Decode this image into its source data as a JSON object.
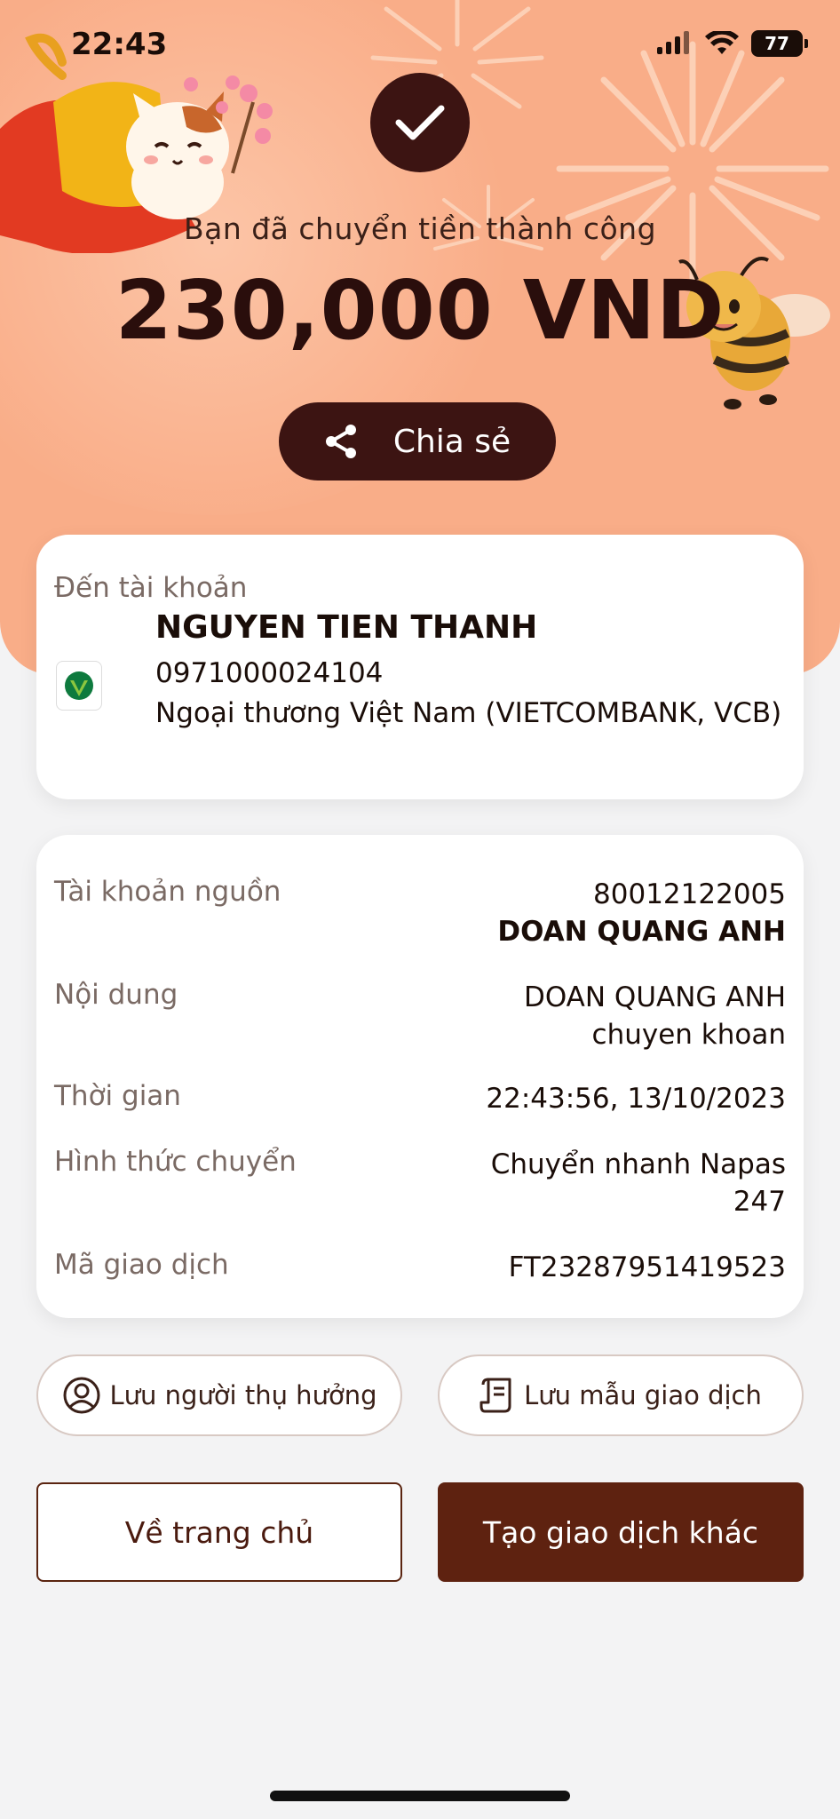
{
  "status_bar": {
    "time": "22:43",
    "battery": "77",
    "icons": [
      "signal-icon",
      "wifi-icon",
      "battery-icon"
    ]
  },
  "colors": {
    "header_bg": "#f9ad88",
    "accent_dark": "#3c1412",
    "primary_button": "#5e2210",
    "page_bg": "#f3f3f4"
  },
  "header": {
    "success_message": "Bạn đã chuyển tiền thành công",
    "amount": "230,000 VND",
    "share_label": "Chia sẻ"
  },
  "recipient": {
    "label": "Đến tài khoản",
    "name": "NGUYEN TIEN THANH",
    "account_number": "0971000024104",
    "bank": "Ngoại thương Việt Nam (VIETCOMBANK, VCB)"
  },
  "details": {
    "source_account_label": "Tài khoản nguồn",
    "source_account_number": "80012122005",
    "source_account_name": "DOAN QUANG ANH",
    "content_label": "Nội dung",
    "content_line1": "DOAN QUANG ANH",
    "content_line2": "chuyen khoan",
    "time_label": "Thời gian",
    "time_value": "22:43:56, 13/10/2023",
    "method_label": "Hình thức chuyển",
    "method_line1": "Chuyển nhanh Napas",
    "method_line2": "247",
    "transaction_id_label": "Mã giao dịch",
    "transaction_id": "FT23287951419523"
  },
  "actions": {
    "save_beneficiary": "Lưu người thụ hưởng",
    "save_template": "Lưu mẫu giao dịch",
    "home": "Về trang chủ",
    "new_transaction": "Tạo giao dịch khác"
  }
}
